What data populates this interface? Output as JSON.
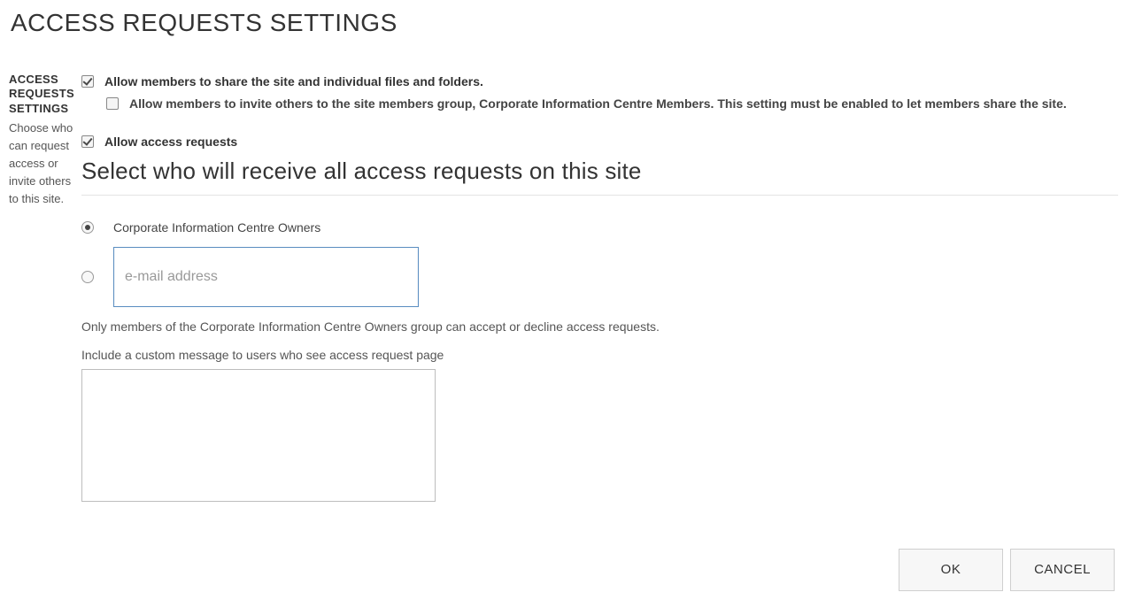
{
  "page": {
    "title": "ACCESS REQUESTS SETTINGS"
  },
  "sidebar": {
    "heading": "ACCESS REQUESTS SETTINGS",
    "description": "Choose who can request access or invite others to this site."
  },
  "settings": {
    "allowShare": {
      "label": "Allow members to share the site and individual files and folders.",
      "checked": true
    },
    "allowInvite": {
      "label": "Allow members to invite others to the site members group, Corporate Information Centre Members. This setting must be enabled to let members share the site.",
      "checked": false
    },
    "allowAccessRequests": {
      "label": "Allow access requests",
      "checked": true
    }
  },
  "receive": {
    "heading": "Select who will receive all access requests on this site",
    "optionOwners": {
      "label": "Corporate Information Centre Owners",
      "selected": true
    },
    "optionEmail": {
      "selected": false,
      "placeholder": "e-mail address",
      "value": ""
    },
    "hint": "Only members of the Corporate Information Centre Owners group can accept or decline access requests.",
    "customMessageLabel": "Include a custom message to users who see access request page",
    "customMessageValue": ""
  },
  "buttons": {
    "ok": "OK",
    "cancel": "CANCEL"
  }
}
